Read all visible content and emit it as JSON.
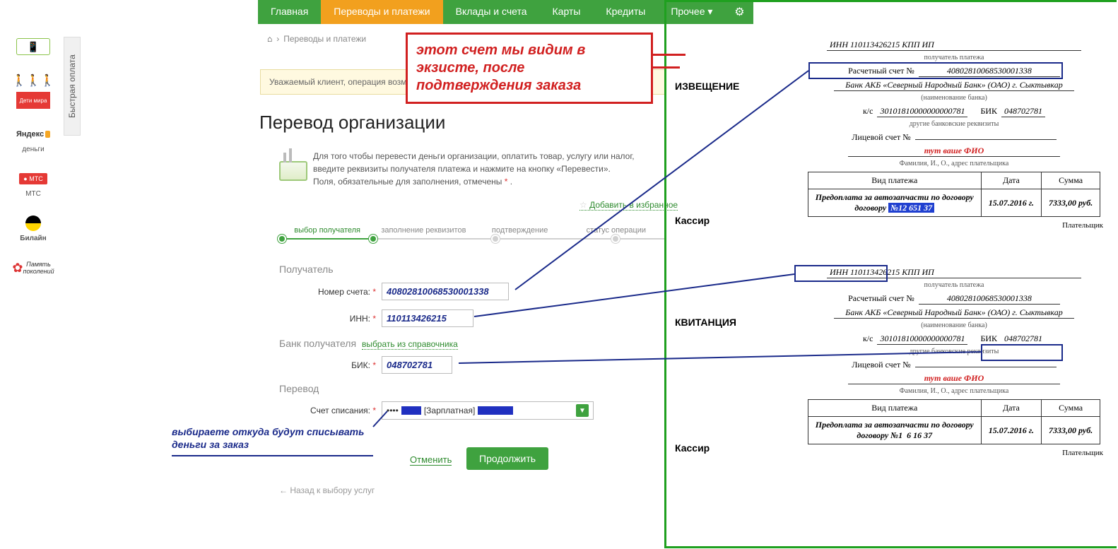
{
  "nav": {
    "tabs": [
      "Главная",
      "Переводы и платежи",
      "Вклады и счета",
      "Карты",
      "Кредиты",
      "Прочее ▾"
    ]
  },
  "breadcrumb": {
    "home": "⌂",
    "sep": "›",
    "page": "Переводы и платежи"
  },
  "notice": "Уважаемый клиент, операция возмо",
  "title": "Перевод организации",
  "intro": {
    "line1": "Для того чтобы перевести деньги организации, оплатить товар, услугу или налог, введите реквизиты получателя платежа и нажмите на кнопку «Перевести».",
    "line2": "Поля, обязательные для заполнения, отмечены ",
    "star": "*",
    "dot": " ."
  },
  "addfav": "Добавить в избранное",
  "steps": [
    "выбор получателя",
    "заполнение реквизитов",
    "подтверждение",
    "статус операции"
  ],
  "sections": {
    "recipient": "Получатель",
    "bank": "Банк получателя",
    "transfer": "Перевод"
  },
  "form": {
    "account": {
      "label": "Номер счета:",
      "value": "40802810068530001338"
    },
    "inn": {
      "label": "ИНН:",
      "value": "110113426215"
    },
    "bankref": "выбрать из справочника",
    "bik": {
      "label": "БИК:",
      "value": "048702781"
    },
    "writeoff": {
      "label": "Счет списания:",
      "value": "•••• ",
      "tag": "[Зарплатная]",
      "arrow": "▼"
    }
  },
  "buttons": {
    "cancel": "Отменить",
    "continue": "Продолжить",
    "back": "←  Назад к выбору услуг"
  },
  "sidebar": {
    "quickpay": "Быстрая оплата",
    "items": [
      {
        "icon": "phone",
        "label": ""
      },
      {
        "icon": "people",
        "label": ""
      },
      {
        "icon": "redbar",
        "label": ""
      },
      {
        "icon": "yandex",
        "label": "деньги"
      },
      {
        "icon": "mts",
        "label": "МТС"
      },
      {
        "icon": "beeline",
        "label": "Билайн"
      },
      {
        "icon": "flower",
        "label": ""
      }
    ]
  },
  "anno": {
    "red": "этот счет мы видим в экзисте, после подтверждения заказа",
    "blue": "выбираете откуда будут списывать деньги за заказ"
  },
  "receipt": {
    "notice": "ИЗВЕЩЕНИЕ",
    "kassir": "Кассир",
    "kvit": "КВИТАНЦИЯ",
    "inn_line": "ИНН 110113426215 КПП    ИП ",
    "recipient_cap": "получатель платежа",
    "acc_lbl": "Расчетный счет №",
    "acc_val": "40802810068530001338",
    "bank": "Банк АКБ «Северный Народный Банк» (ОАО) г. Сыктывкар",
    "bank_cap": "(наименование банка)",
    "ks_lbl": "к/с",
    "ks_val": "30101810000000000781",
    "bik_lbl": "БИК",
    "bik_val": "048702781",
    "other_cap": "другие банковские реквизиты",
    "lic_lbl": "Лицевой счет №",
    "fio": "тут ваше ФИО",
    "fio_cap": "Фамилия, И., О., адрес плательщика",
    "th1": "Вид платежа",
    "th2": "Дата",
    "th3": "Сумма",
    "td1a": "Предоплата за автозапчасти по договору",
    "td1b": "№1",
    "td1c": "6  16  37",
    "td1sel": "№12  651  37",
    "td2": "15.07.2016 г.",
    "td3": "7333,00 руб.",
    "payer": "Плательщик"
  }
}
